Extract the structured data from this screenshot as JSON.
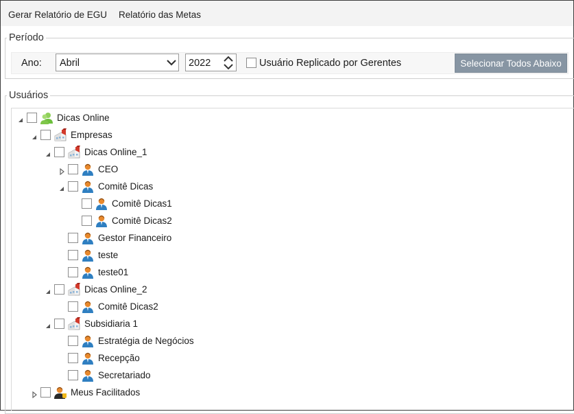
{
  "menu": {
    "item_1": "Gerar Relatório de EGU",
    "item_2": "Relatório das Metas"
  },
  "periodo": {
    "legend": "Período",
    "ano_label": "Ano:",
    "month_value": "Abril",
    "year_value": "2022",
    "replicated_label": "Usuário Replicado por Gerentes",
    "replicated_checked": false,
    "select_all_button": "Selecionar Todos Abaixo"
  },
  "usuarios": {
    "legend": "Usuários",
    "tree": [
      {
        "label": "Dicas Online",
        "icon": "user-group-icon",
        "level": 0,
        "expander": "expanded"
      },
      {
        "label": "Empresas",
        "icon": "company-icon",
        "level": 1,
        "expander": "expanded"
      },
      {
        "label": "Dicas Online_1",
        "icon": "company-icon",
        "level": 2,
        "expander": "expanded"
      },
      {
        "label": "CEO",
        "icon": "user-icon",
        "level": 3,
        "expander": "collapsed"
      },
      {
        "label": "Comitê Dicas",
        "icon": "user-icon",
        "level": 3,
        "expander": "expanded"
      },
      {
        "label": "Comitê Dicas1",
        "icon": "user-icon",
        "level": 4,
        "expander": "none"
      },
      {
        "label": "Comitê Dicas2",
        "icon": "user-icon",
        "level": 4,
        "expander": "none"
      },
      {
        "label": "Gestor Financeiro",
        "icon": "user-icon",
        "level": 3,
        "expander": "none"
      },
      {
        "label": "teste",
        "icon": "user-icon",
        "level": 3,
        "expander": "none"
      },
      {
        "label": "teste01",
        "icon": "user-icon",
        "level": 3,
        "expander": "none"
      },
      {
        "label": "Dicas Online_2",
        "icon": "company-icon",
        "level": 2,
        "expander": "expanded"
      },
      {
        "label": "Comitê Dicas2",
        "icon": "user-icon",
        "level": 3,
        "expander": "none"
      },
      {
        "label": "Subsidiaria 1",
        "icon": "company-icon",
        "level": 2,
        "expander": "expanded"
      },
      {
        "label": "Estratégia de Negócios",
        "icon": "user-icon",
        "level": 3,
        "expander": "none"
      },
      {
        "label": "Recepção",
        "icon": "user-icon",
        "level": 3,
        "expander": "none"
      },
      {
        "label": "Secretariado",
        "icon": "user-icon",
        "level": 3,
        "expander": "none"
      },
      {
        "label": "Meus Facilitados",
        "icon": "facilitated-user-icon",
        "level": 1,
        "expander": "collapsed"
      }
    ]
  },
  "colors": {
    "menubar": "#f3f3f3",
    "button": "#8795a3",
    "user_orange": "#e8892d",
    "user_head": "#2f7fc1",
    "group_green": "#6cbf3c",
    "company_red": "#d23a2b"
  }
}
